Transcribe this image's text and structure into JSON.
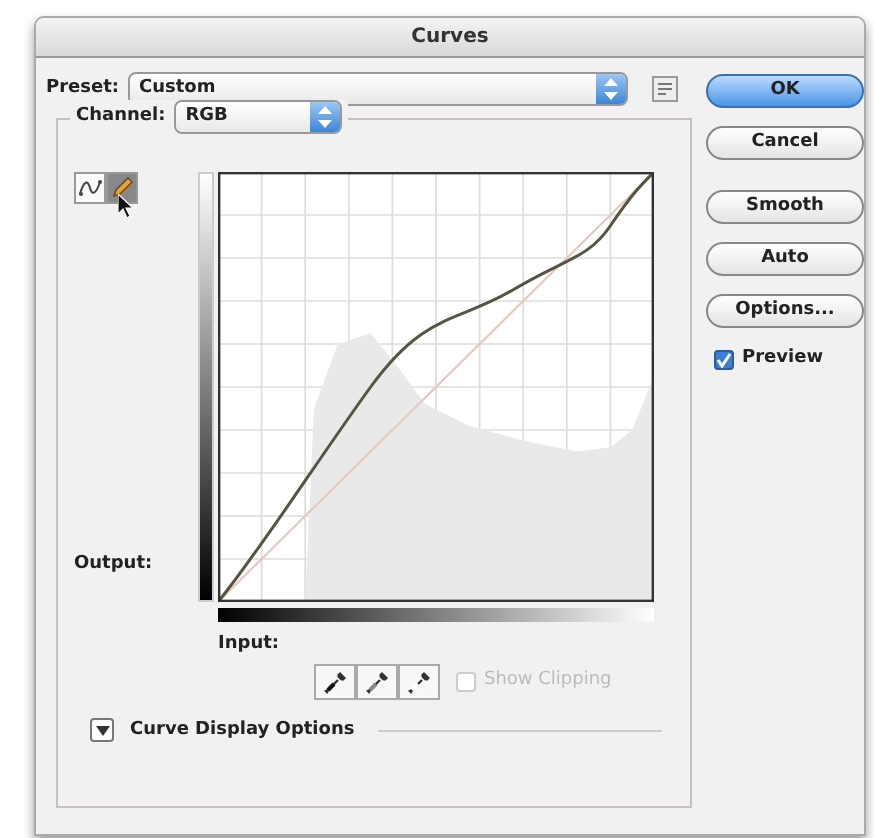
{
  "window": {
    "title": "Curves"
  },
  "preset": {
    "label": "Preset:",
    "value": "Custom"
  },
  "channel": {
    "label": "Channel:",
    "value": "RGB"
  },
  "curve_tools": [
    {
      "kind": "points",
      "selected": false
    },
    {
      "kind": "pencil",
      "selected": true
    }
  ],
  "output_label": "Output:",
  "input_label": "Input:",
  "eyedroppers": [
    {
      "kind": "black"
    },
    {
      "kind": "gray"
    },
    {
      "kind": "white"
    }
  ],
  "show_clipping": {
    "label": "Show Clipping",
    "checked": false,
    "disabled": true
  },
  "curve_display_options": {
    "label": "Curve Display Options",
    "expanded": false
  },
  "buttons": [
    {
      "label": "OK",
      "default": true
    },
    {
      "label": "Cancel",
      "default": false
    },
    {
      "label": "Smooth",
      "default": false
    },
    {
      "label": "Auto",
      "default": false
    },
    {
      "label": "Options...",
      "default": false
    }
  ],
  "preview": {
    "label": "Preview",
    "checked": true
  }
}
